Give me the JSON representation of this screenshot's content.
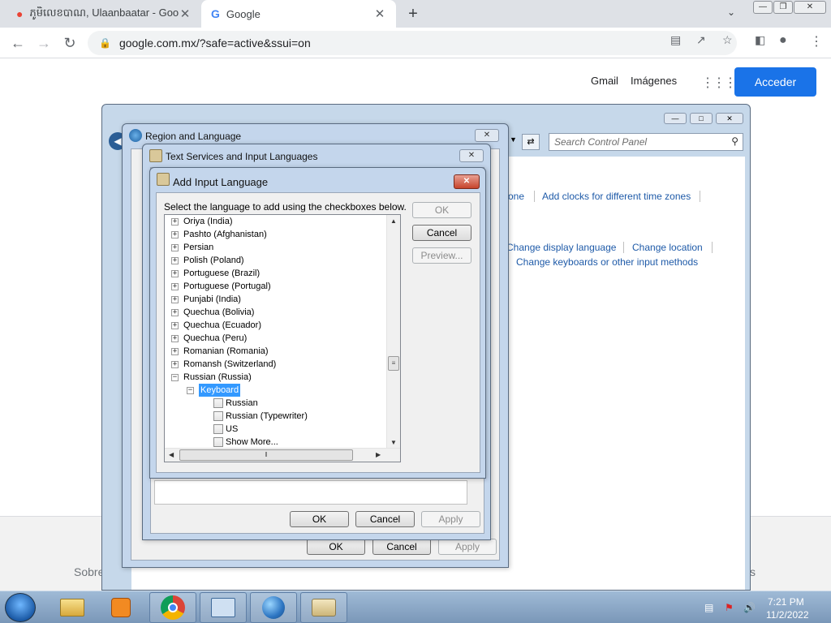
{
  "browser": {
    "tabs": [
      {
        "title": "ភូមិលេខបាណ, Ulaanbaatar - Goog",
        "icon": "maps-pin-icon"
      },
      {
        "title": "Google",
        "icon": "google-g-icon"
      }
    ],
    "new_tab": "+",
    "url": "google.com.mx/?safe=active&ssui=on"
  },
  "google_page": {
    "gmail": "Gmail",
    "images": "Imágenes",
    "signin": "Acceder",
    "footer_left": "Sobre",
    "footer_right": "s"
  },
  "control_panel": {
    "search_placeholder": "Search Control Panel",
    "links": {
      "time_zone": "one",
      "clocks": "Add clocks for different time zones",
      "display_language": "Change display language",
      "location": "Change location",
      "keyboards": "Change keyboards or other input methods"
    }
  },
  "region_dialog": {
    "title": "Region and Language",
    "ok": "OK",
    "cancel": "Cancel",
    "apply": "Apply"
  },
  "text_services_dialog": {
    "title": "Text Services and Input Languages",
    "ok": "OK",
    "cancel": "Cancel",
    "apply": "Apply"
  },
  "add_input_dialog": {
    "title": "Add Input Language",
    "instruction": "Select the language to add using the checkboxes below.",
    "ok": "OK",
    "cancel": "Cancel",
    "preview": "Preview...",
    "languages": [
      "Oriya (India)",
      "Pashto (Afghanistan)",
      "Persian",
      "Polish (Poland)",
      "Portuguese (Brazil)",
      "Portuguese (Portugal)",
      "Punjabi (India)",
      "Quechua (Bolivia)",
      "Quechua (Ecuador)",
      "Quechua (Peru)",
      "Romanian (Romania)",
      "Romansh (Switzerland)",
      "Russian (Russia)"
    ],
    "keyboard_label": "Keyboard",
    "keyboards": [
      "Russian",
      "Russian (Typewriter)",
      "US",
      "Show More..."
    ]
  },
  "taskbar": {
    "time": "7:21 PM",
    "date": "11/2/2022"
  }
}
